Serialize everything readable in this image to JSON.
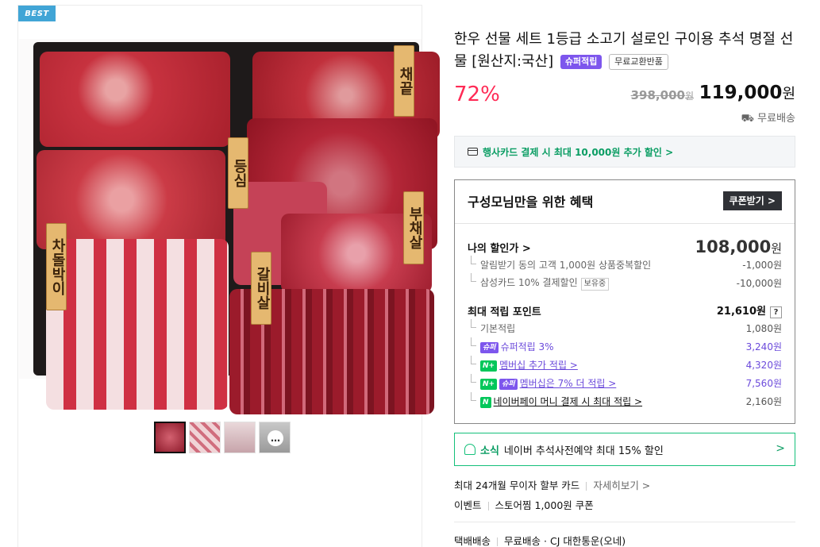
{
  "left": {
    "badge": "BEST",
    "tags": [
      "채끝",
      "등심",
      "부채살",
      "갈비살",
      "차돌박이"
    ],
    "thumbnails": [
      "thumb-1",
      "thumb-2",
      "thumb-3",
      "thumb-more"
    ],
    "more_icon": "…"
  },
  "product": {
    "title": "한우 선물 세트 1등급 소고기 설로인 구이용 추석 명절 선물 [원산지:국산]",
    "badge_super": "슈퍼적립",
    "badge_free": "무료교환반품",
    "discount": "72%",
    "original_price": "398,000",
    "original_unit": "원",
    "price": "119,000",
    "price_unit": "원",
    "shipping": "무료배송"
  },
  "card_promo": {
    "text": "행사카드 결제 시 최대 10,000원 추가 할인 >",
    "icon": "card-icon"
  },
  "benefit": {
    "heading": "구성모님만을 위한 혜택",
    "coupon_button": "쿠폰받기 >",
    "my_discount": {
      "label": "나의 할인가 >",
      "price": "108,000",
      "unit": "원",
      "items": [
        {
          "label": "알림받기 동의 고객 1,000원 상품중복할인",
          "value": "-1,000원"
        },
        {
          "label": "삼성카드 10% 결제할인",
          "tag": "보유중",
          "value": "-10,000원"
        }
      ]
    },
    "points": {
      "label": "최대 적립 포인트",
      "value": "21,610원",
      "help": "?",
      "items": [
        {
          "label": "기본적립",
          "value": "1,080원"
        },
        {
          "label": "슈퍼적립 3%",
          "value": "3,240원",
          "badge": "슈퍼"
        },
        {
          "label": "멤버십 추가 적립 >",
          "value": "4,320원",
          "badge": "N+"
        },
        {
          "label": "멤버십은 7% 더 적립 >",
          "value": "7,560원",
          "badge": "N+",
          "badge2": "슈퍼"
        },
        {
          "label": "네이버페이 머니 결제 시 최대 적립 >",
          "value": "2,160원",
          "badge": "N"
        }
      ]
    }
  },
  "news": {
    "label": "소식",
    "text": "네이버 추석사전예약 최대 15% 할인",
    "arrow": ">"
  },
  "info": {
    "installment": "최대 24개월 무이자 할부 카드",
    "installment_link": "자세히보기 >",
    "event_label": "이벤트",
    "event_text": "스토어찜 1,000원 쿠폰",
    "delivery_label": "택배배송",
    "delivery_fee": "무료배송",
    "courier": "· CJ 대한통운(오네)"
  },
  "colors": {
    "discount": "#ff2a55",
    "benefit_price": "#c6002a",
    "naver_green": "#03c75a",
    "super_purple": "#7d56ed"
  }
}
